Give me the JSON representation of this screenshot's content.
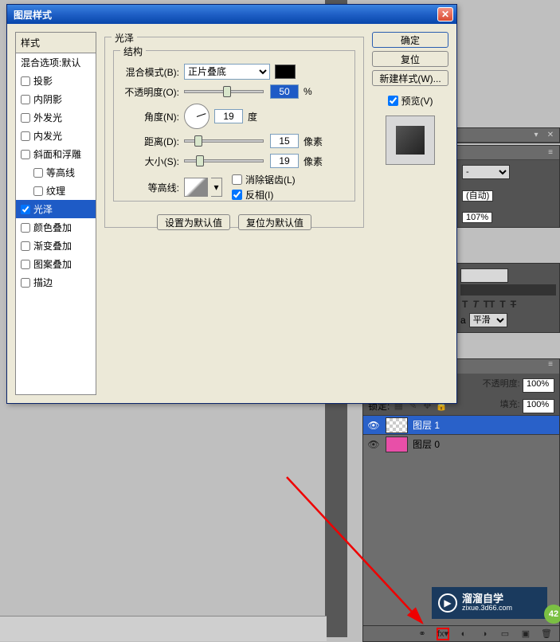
{
  "dialog": {
    "title": "图层样式",
    "styles_header": "样式",
    "blend_options": "混合选项:默认",
    "effects": [
      {
        "label": "投影",
        "checked": false
      },
      {
        "label": "内阴影",
        "checked": false
      },
      {
        "label": "外发光",
        "checked": false
      },
      {
        "label": "内发光",
        "checked": false
      },
      {
        "label": "斜面和浮雕",
        "checked": false
      },
      {
        "label": "等高线",
        "checked": false,
        "indent": true
      },
      {
        "label": "纹理",
        "checked": false,
        "indent": true
      },
      {
        "label": "光泽",
        "checked": true,
        "selected": true
      },
      {
        "label": "颜色叠加",
        "checked": false
      },
      {
        "label": "渐变叠加",
        "checked": false
      },
      {
        "label": "图案叠加",
        "checked": false
      },
      {
        "label": "描边",
        "checked": false
      }
    ],
    "group_title": "光泽",
    "structure_title": "结构",
    "blend_mode_label": "混合模式(B):",
    "blend_mode_value": "正片叠底",
    "opacity_label": "不透明度(O):",
    "opacity_value": "50",
    "opacity_unit": "%",
    "angle_label": "角度(N):",
    "angle_value": "19",
    "angle_unit": "度",
    "distance_label": "距离(D):",
    "distance_value": "15",
    "distance_unit": "像素",
    "size_label": "大小(S):",
    "size_value": "19",
    "size_unit": "像素",
    "contour_label": "等高线:",
    "antialias_label": "消除锯齿(L)",
    "invert_label": "反相(I)",
    "set_default_btn": "设置为默认值",
    "reset_default_btn": "复位为默认值",
    "ok_btn": "确定",
    "cancel_btn": "复位",
    "new_style_btn": "新建样式(W)...",
    "preview_label": "预览(V)"
  },
  "right_panels": {
    "select_dash": "-",
    "auto_label": "(自动)",
    "percent_107": "107%"
  },
  "char_panel": {
    "icons": [
      "T",
      "T",
      "TT",
      "T",
      "T"
    ],
    "smooth_label": "平滑"
  },
  "layers": {
    "opacity_label": "不透明度:",
    "opacity_value": "100%",
    "fill_label": "填充:",
    "fill_value": "100%",
    "lock_label": "锁定:",
    "layer1": "图层 1",
    "layer0": "图层 0"
  },
  "watermark": {
    "title": "溜溜自学",
    "url": "zixue.3d66.com"
  },
  "badge": "42"
}
